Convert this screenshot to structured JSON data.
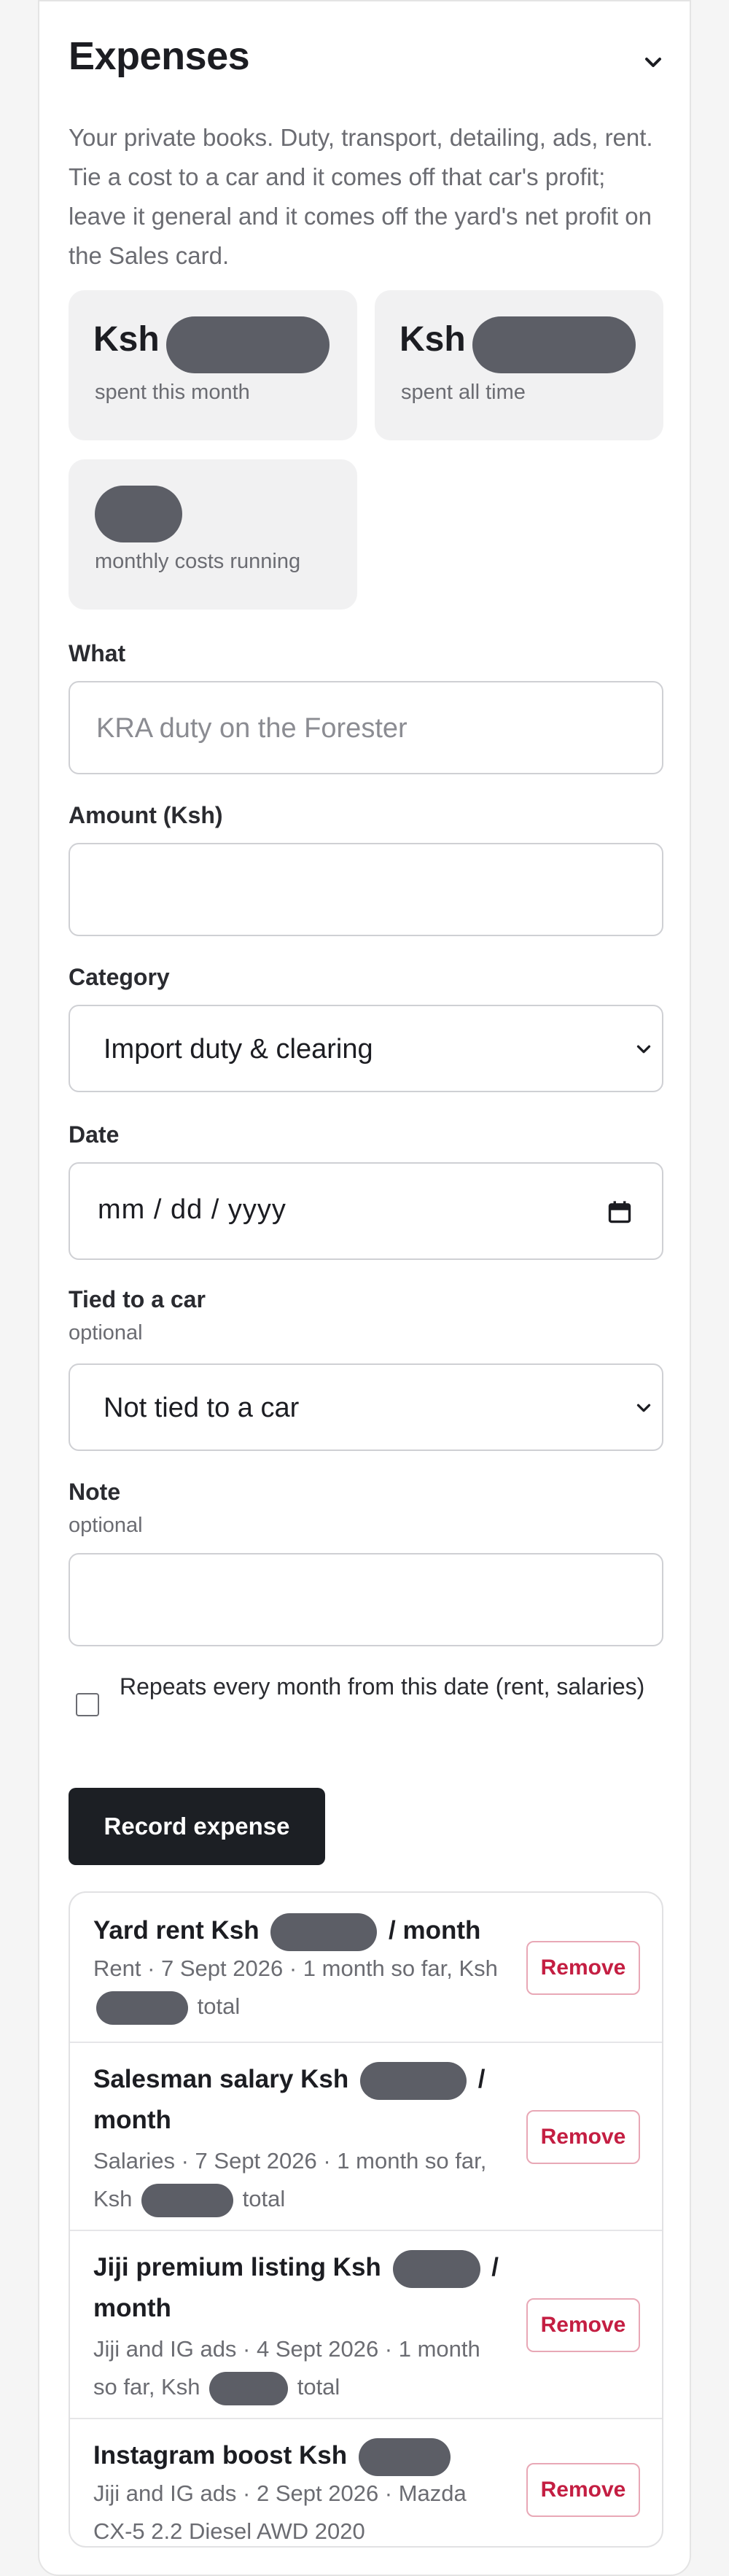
{
  "section": {
    "title": "Expenses",
    "intro": "Your private books. Duty, transport, detailing, ads, rent. Tie a cost to a car and it comes off that car's profit; leave it general and it comes off the yard's net profit on the Sales card."
  },
  "stats": {
    "month": {
      "currency": "Ksh",
      "caption": "spent this month"
    },
    "all_time": {
      "currency": "Ksh",
      "caption": "spent all time"
    },
    "recurring": {
      "caption": "monthly costs running"
    }
  },
  "form": {
    "what": {
      "label": "What",
      "placeholder": "KRA duty on the Forester",
      "value": ""
    },
    "amount": {
      "label": "Amount (Ksh)",
      "value": ""
    },
    "category": {
      "label": "Category",
      "value": "Import duty & clearing"
    },
    "date": {
      "label": "Date",
      "value": "mm / dd / yyyy"
    },
    "car": {
      "label": "Tied to a car",
      "sublabel": "optional",
      "value": "Not tied to a car"
    },
    "note": {
      "label": "Note",
      "sublabel": "optional",
      "value": ""
    },
    "repeat": {
      "label": "Repeats every month from this date (rent, salaries)",
      "checked": false
    },
    "submit_label": "Record expense"
  },
  "expenses": [
    {
      "title_prefix": "Yard rent Ksh",
      "title_suffix": "/ month",
      "sub_prefix": "Rent · 7 Sept 2026 · 1 month so far, Ksh",
      "sub_suffix": "total",
      "remove_label": "Remove"
    },
    {
      "title_prefix": "Salesman salary Ksh",
      "title_suffix": "/ month",
      "sub_prefix": "Salaries · 7 Sept 2026 · 1 month so far, Ksh",
      "sub_suffix": "total",
      "remove_label": "Remove"
    },
    {
      "title_prefix": "Jiji premium listing Ksh",
      "title_suffix": "/ month",
      "sub_prefix": "Jiji and IG ads · 4 Sept 2026 · 1 month so far, Ksh",
      "sub_suffix": "total",
      "remove_label": "Remove"
    },
    {
      "title_prefix": "Instagram boost Ksh",
      "title_suffix": "",
      "sub_prefix": "Jiji and IG ads · 2 Sept 2026 · Mazda CX-5 2.2 Diesel AWD 2020",
      "sub_suffix": "",
      "remove_label": "Remove"
    }
  ],
  "colors": {
    "accent_dark": "#1c1f24",
    "remove_red": "#c41e42",
    "redacted_pill": "#5c5e66"
  }
}
